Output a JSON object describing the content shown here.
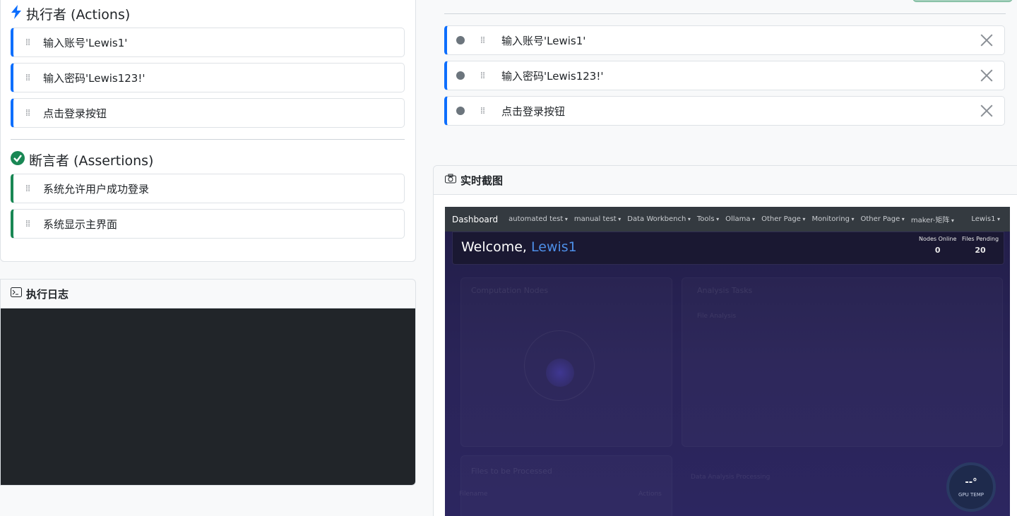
{
  "actions": {
    "title": "执行者 (Actions)",
    "steps": [
      "输入账号'Lewis1'",
      "输入密码'Lewis123!'",
      "点击登录按钮"
    ]
  },
  "assertions": {
    "title": "断言者 (Assertions)",
    "steps": [
      "系统允许用户成功登录",
      "系统显示主界面"
    ]
  },
  "log": {
    "title": "执行日志"
  },
  "selected_steps": [
    "输入账号'Lewis1'",
    "输入密码'Lewis123!'",
    "点击登录按钮"
  ],
  "screenshot": {
    "title": "实时截图",
    "app": {
      "brand": "Dashboard",
      "nav": [
        "automated test",
        "manual test",
        "Data Workbench",
        "Tools",
        "Ollama",
        "Other Page",
        "Monitoring",
        "Other Page",
        "maker-矩阵"
      ],
      "user": "Lewis1",
      "welcome_prefix": "Welcome,",
      "welcome_user": "Lewis1",
      "stats": [
        {
          "label": "Nodes Online",
          "value": "0"
        },
        {
          "label": "Files Pending",
          "value": "20"
        }
      ],
      "faded": {
        "computation_nodes": "Computation Nodes",
        "analysis_tasks": "Analysis Tasks",
        "file_analysis": "File Analysis",
        "files_processed": "Files to be Processed",
        "data_analysis": "Data Analysis Processing",
        "filename": "Filename",
        "actions": "Actions"
      },
      "gauge": {
        "value": "--°",
        "label": "GPU TEMP"
      }
    }
  },
  "colors": {
    "action_accent": "#0d6efd",
    "assertion_accent": "#198754",
    "log_bg": "#212529"
  }
}
